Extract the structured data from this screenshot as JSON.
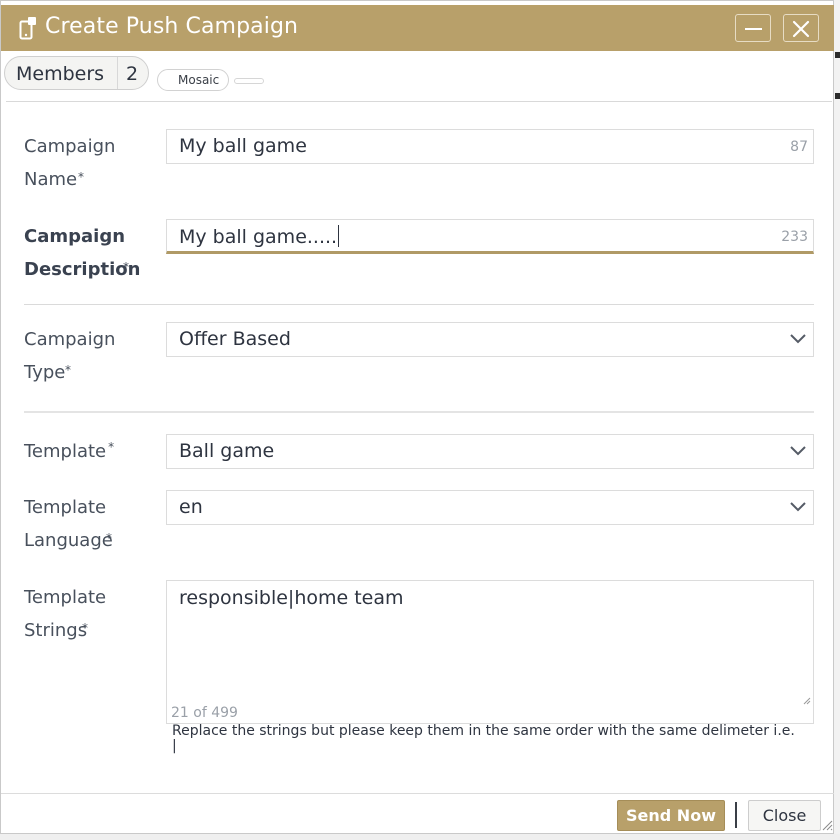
{
  "window": {
    "title": "Create Push Campaign",
    "icon": "mobile-push-icon",
    "minimize_icon": "minimize-icon",
    "close_icon": "close-icon",
    "accent_color": "#b8a06a"
  },
  "tabs": {
    "members_label": "Members",
    "members_count": "2",
    "mosaic_label": "Mosaic"
  },
  "form": {
    "campaign_name": {
      "label": "Campaign Name",
      "value": "My ball game",
      "counter": "87"
    },
    "campaign_description": {
      "label": "Campaign Description",
      "value": "My ball game.....",
      "counter": "233"
    },
    "campaign_type": {
      "label": "Campaign Type",
      "value": "Offer Based"
    },
    "template": {
      "label": "Template",
      "value": "Ball game"
    },
    "template_language": {
      "label": "Template Language",
      "value": "en"
    },
    "template_strings": {
      "label": "Template Strings",
      "value": "responsible|home team",
      "counter": "21 of 499",
      "hint": "Replace the strings but please keep them in the same order with the same delimeter i.e. |"
    },
    "required_marker": "*"
  },
  "footer": {
    "send_label": "Send Now",
    "close_label": "Close"
  }
}
